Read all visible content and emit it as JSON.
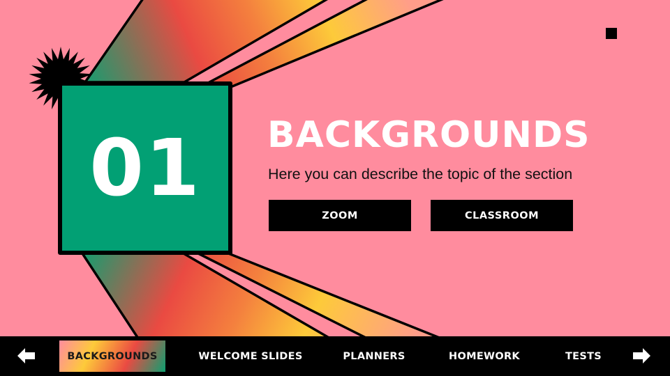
{
  "slide": {
    "section_number": "01",
    "title": "BACKGROUNDS",
    "subtitle": "Here you can describe the topic of the section",
    "buttons": [
      {
        "label": "ZOOM"
      },
      {
        "label": "CLASSROOM"
      }
    ]
  },
  "navbar": {
    "prev_icon": "arrow-left-icon",
    "next_icon": "arrow-right-icon",
    "items": [
      {
        "label": "BACKGROUNDS",
        "active": true
      },
      {
        "label": "WELCOME SLIDES",
        "active": false
      },
      {
        "label": "PLANNERS",
        "active": false
      },
      {
        "label": "HOMEWORK",
        "active": false
      },
      {
        "label": "TESTS",
        "active": false
      }
    ]
  },
  "colors": {
    "background": "#ff8c9e",
    "accent_green": "#02a074",
    "gradient": [
      "#ff8c9e",
      "#fdca3a",
      "#f4803e",
      "#ea4a42",
      "#0da071"
    ],
    "navbar": "#000000",
    "text_light": "#ffffff",
    "text_dark": "#111111"
  }
}
